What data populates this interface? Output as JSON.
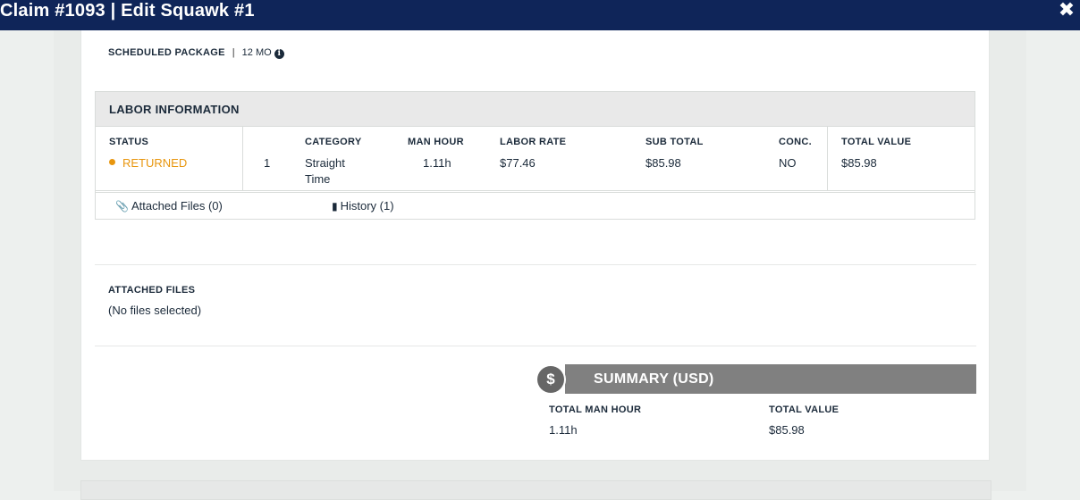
{
  "window": {
    "title": "Claim #1093 | Edit Squawk #1",
    "close_icon": "close-icon"
  },
  "scheduled": {
    "label": "SCHEDULED PACKAGE",
    "separator": "|",
    "value": "12 MO",
    "info_icon": "info-icon"
  },
  "labor": {
    "heading": "LABOR INFORMATION",
    "columns": {
      "status": "STATUS",
      "category": "CATEGORY",
      "man_hour": "MAN HOUR",
      "labor_rate": "LABOR RATE",
      "sub_total": "SUB TOTAL",
      "conc": "CONC.",
      "total_value": "TOTAL VALUE"
    },
    "row": {
      "status": "RETURNED",
      "status_color": "#e8960e",
      "index": "1",
      "category_line1": "Straight",
      "category_line2": "Time",
      "man_hour": "1.11h",
      "labor_rate": "$77.46",
      "sub_total": "$85.98",
      "conc": "NO",
      "total_value": "$85.98"
    },
    "links": {
      "attached_files": "Attached Files (0)",
      "attached_icon": "paperclip-icon",
      "history": "History (1)",
      "history_icon": "book-icon"
    }
  },
  "attached_files": {
    "label": "ATTACHED FILES",
    "value": "(No files selected)"
  },
  "summary": {
    "title": "SUMMARY (USD)",
    "icon": "dollar-icon",
    "total_man_hour_label": "TOTAL MAN HOUR",
    "total_man_hour": "1.11h",
    "total_value_label": "TOTAL VALUE",
    "total_value": "$85.98"
  },
  "colors": {
    "titlebar": "#0f2559",
    "accent_status": "#e8960e",
    "summary_bar": "#808080"
  }
}
